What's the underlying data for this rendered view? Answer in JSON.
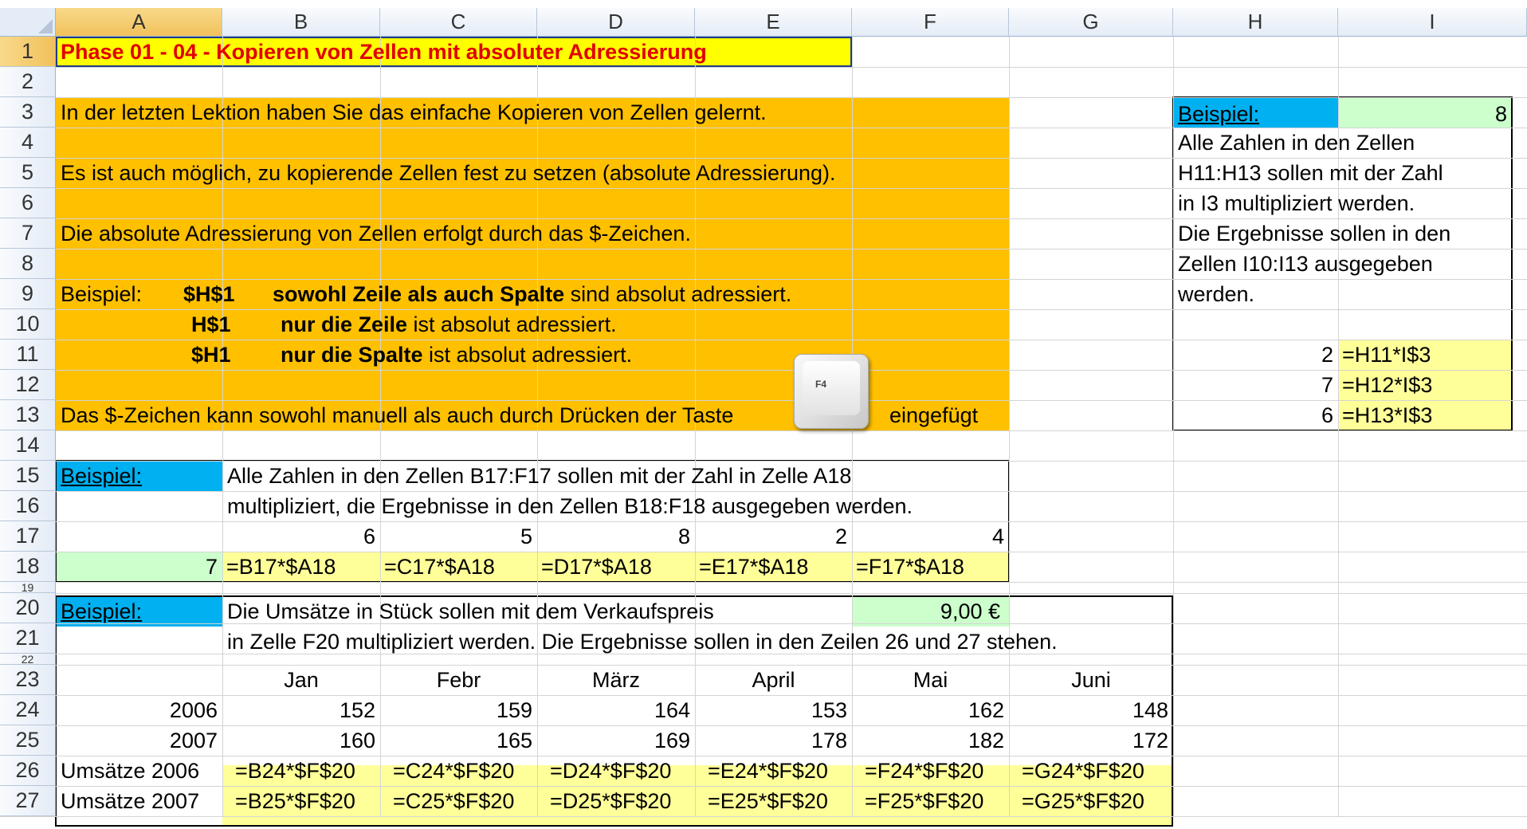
{
  "columns": [
    "A",
    "B",
    "C",
    "D",
    "E",
    "F",
    "G",
    "H",
    "I"
  ],
  "rows": [
    "1",
    "2",
    "3",
    "4",
    "5",
    "6",
    "7",
    "8",
    "9",
    "10",
    "11",
    "12",
    "13",
    "14",
    "15",
    "16",
    "17",
    "18",
    "19",
    "20",
    "21",
    "22",
    "23",
    "24",
    "25",
    "26",
    "27"
  ],
  "title": "Phase 01 - 04 - Kopieren von Zellen mit absoluter Adressierung",
  "intro": {
    "line1": "In der letzten Lektion haben Sie das einfache Kopieren von Zellen gelernt.",
    "line2": "Es ist auch möglich, zu kopierende Zellen fest zu setzen (absolute Adressierung).",
    "line3": "Die absolute Adressierung von Zellen erfolgt durch das $-Zeichen.",
    "beispiel_label": "Beispiel:",
    "ex1_ref": "$H$1",
    "ex1_bold": "sowohl Zeile als auch Spalte",
    "ex1_rest": " sind absolut adressiert.",
    "ex2_ref": "H$1",
    "ex2_bold": "nur die Zeile",
    "ex2_rest": " ist absolut adressiert.",
    "ex3_ref": "$H1",
    "ex3_bold": "nur die Spalte",
    "ex3_rest": " ist absolut adressiert.",
    "line13a": "Das $-Zeichen kann sowohl manuell als auch durch Drücken der Taste",
    "f4_label": "F4",
    "line13b": "eingefügt"
  },
  "side_example": {
    "label": "Beispiel:",
    "value": "8",
    "text": [
      "Alle Zahlen in den Zellen",
      "H11:H13 sollen mit der Zahl",
      "in I3 multipliziert werden.",
      "Die Ergebnisse sollen in den",
      "Zellen I10:I13 ausgegeben",
      "werden."
    ],
    "rows": [
      {
        "num": "2",
        "formula": "=H11*I$3"
      },
      {
        "num": "7",
        "formula": "=H12*I$3"
      },
      {
        "num": "6",
        "formula": "=H13*I$3"
      }
    ]
  },
  "example2": {
    "label": "Beispiel:",
    "text1": "Alle Zahlen in den Zellen B17:F17 sollen mit der Zahl in Zelle A18",
    "text2": "multipliziert, die Ergebnisse in den Zellen B18:F18 ausgegeben werden.",
    "numbers": [
      "6",
      "5",
      "8",
      "2",
      "4"
    ],
    "multiplier": "7",
    "formulas": [
      "=B17*$A18",
      "=C17*$A18",
      "=D17*$A18",
      "=E17*$A18",
      "=F17*$A18"
    ]
  },
  "example3": {
    "label": "Beispiel:",
    "text1": "Die Umsätze in Stück sollen mit dem Verkaufspreis",
    "price": "9,00 €",
    "text2": "in Zelle F20 multipliziert werden. Die Ergebnisse sollen in den Zeilen 26 und 27 stehen.",
    "months": [
      "Jan",
      "Febr",
      "März",
      "April",
      "Mai",
      "Juni"
    ],
    "years": [
      {
        "year": "2006",
        "values": [
          "152",
          "159",
          "164",
          "153",
          "162",
          "148"
        ]
      },
      {
        "year": "2007",
        "values": [
          "160",
          "165",
          "169",
          "178",
          "182",
          "172"
        ]
      }
    ],
    "result_rows": [
      {
        "label": "Umsätze 2006",
        "formulas": [
          "=B24*$F$20",
          "=C24*$F$20",
          "=D24*$F$20",
          "=E24*$F$20",
          "=F24*$F$20",
          "=G24*$F$20"
        ]
      },
      {
        "label": "Umsätze 2007",
        "formulas": [
          "=B25*$F$20",
          "=C25*$F$20",
          "=D25*$F$20",
          "=E25*$F$20",
          "=F25*$F$20",
          "=G25*$F$20"
        ]
      }
    ]
  },
  "colors": {
    "orange": "#ffc000",
    "cyan": "#00b0f0",
    "green": "#ccffcc",
    "yellow": "#ffff99",
    "title_bg": "#ffff00",
    "title_text": "#e00000"
  }
}
